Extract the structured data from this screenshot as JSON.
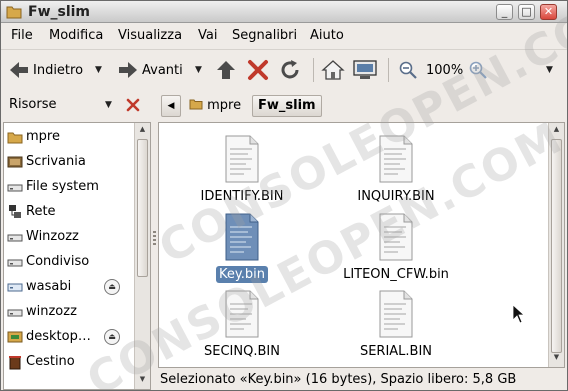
{
  "window": {
    "title": "Fw_slim"
  },
  "menubar": [
    "File",
    "Modifica",
    "Visualizza",
    "Vai",
    "Segnalibri",
    "Aiuto"
  ],
  "toolbar": {
    "back_label": "Indietro",
    "forward_label": "Avanti",
    "zoom_label": "100%"
  },
  "side_header": {
    "label": "Risorse"
  },
  "pathbar": {
    "items": [
      "mpre",
      "Fw_slim"
    ]
  },
  "sidebar": {
    "items": [
      {
        "label": "mpre",
        "icon": "home-folder-icon"
      },
      {
        "label": "Scrivania",
        "icon": "desktop-icon"
      },
      {
        "label": "File system",
        "icon": "drive-icon"
      },
      {
        "label": "Rete",
        "icon": "network-icon"
      },
      {
        "label": "Winzozz",
        "icon": "drive-icon"
      },
      {
        "label": "Condiviso",
        "icon": "drive-icon"
      },
      {
        "label": "wasabi",
        "icon": "network-drive-icon"
      },
      {
        "label": "winzozz",
        "icon": "drive-icon"
      },
      {
        "label": "desktop…",
        "icon": "media-icon"
      },
      {
        "label": "Cestino",
        "icon": "trash-icon"
      }
    ]
  },
  "files": [
    {
      "name": "IDENTIFY.BIN"
    },
    {
      "name": "INQUIRY.BIN"
    },
    {
      "name": "Key.bin"
    },
    {
      "name": "LITEON_CFW.bin"
    },
    {
      "name": "SECINQ.BIN"
    },
    {
      "name": "SERIAL.BIN"
    }
  ],
  "status": {
    "text": "Selezionato «Key.bin» (16 bytes), Spazio libero: 5,8 GB"
  },
  "watermark": {
    "text": "CONSOLEOPEN.COM"
  },
  "colors": {
    "selection": "#5a80ad",
    "close_button": "#d9473b",
    "accent_red": "#c0392b"
  }
}
